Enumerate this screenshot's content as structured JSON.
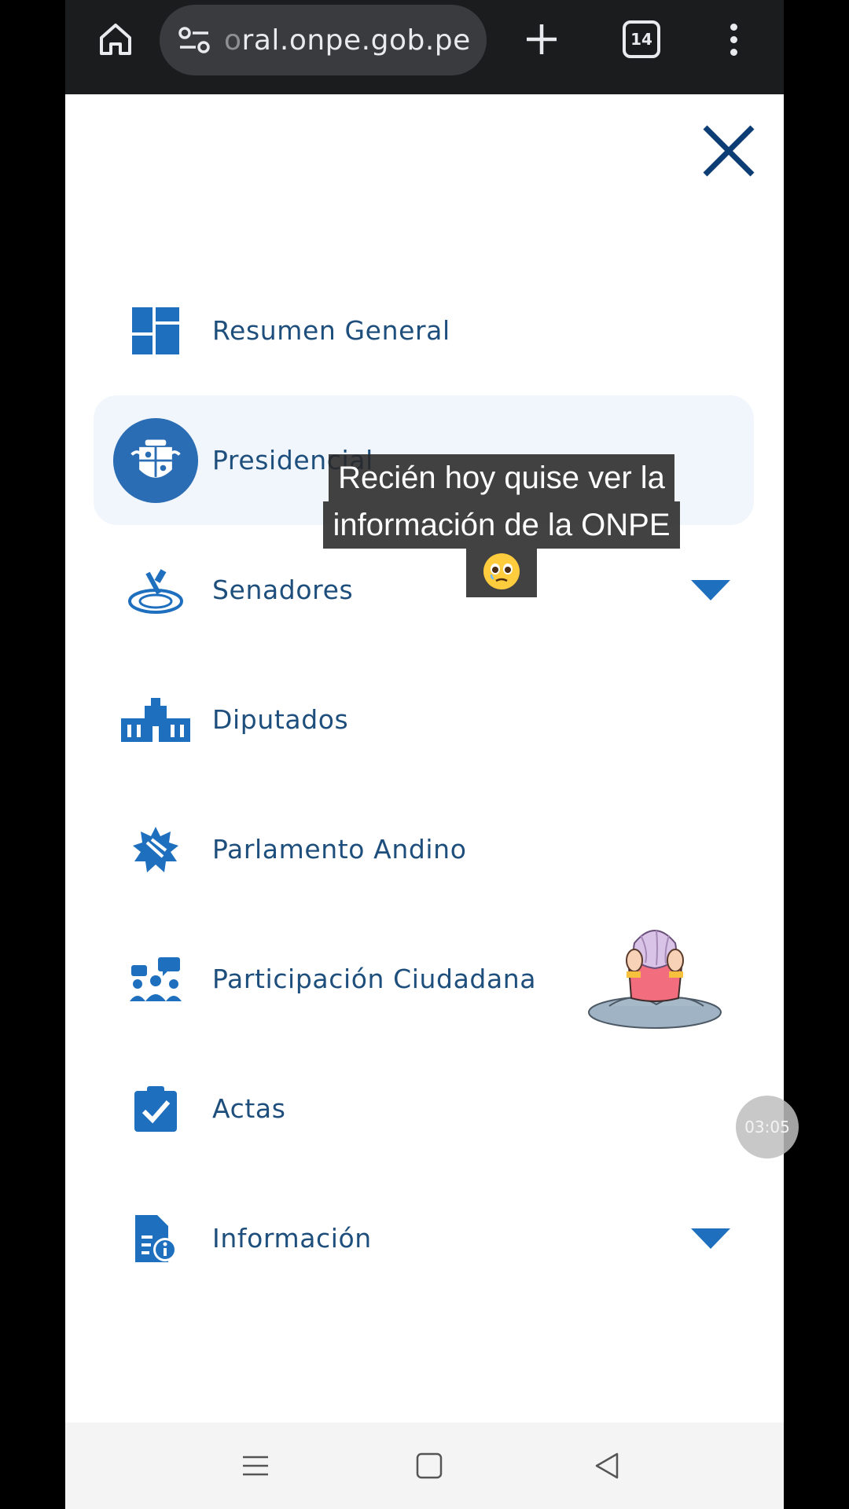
{
  "browser": {
    "url_faded": "o",
    "url": "ral.onpe.gob.pe",
    "tab_count": "14"
  },
  "menu": {
    "items": [
      {
        "label": "Resumen General"
      },
      {
        "label": "Presidencial"
      },
      {
        "label": "Senadores"
      },
      {
        "label": "Diputados"
      },
      {
        "label": "Parlamento Andino"
      },
      {
        "label": "Participación Ciudadana"
      },
      {
        "label": "Actas"
      },
      {
        "label": "Información"
      }
    ]
  },
  "caption": {
    "line1": "Recién hoy quise ver la",
    "line2": "información de la ONPE",
    "emoji": "🥹"
  },
  "timer": "03:05",
  "colors": {
    "accent": "#1f6fbf",
    "label": "#1d4e7c",
    "active_bg": "#f1f6fc"
  }
}
